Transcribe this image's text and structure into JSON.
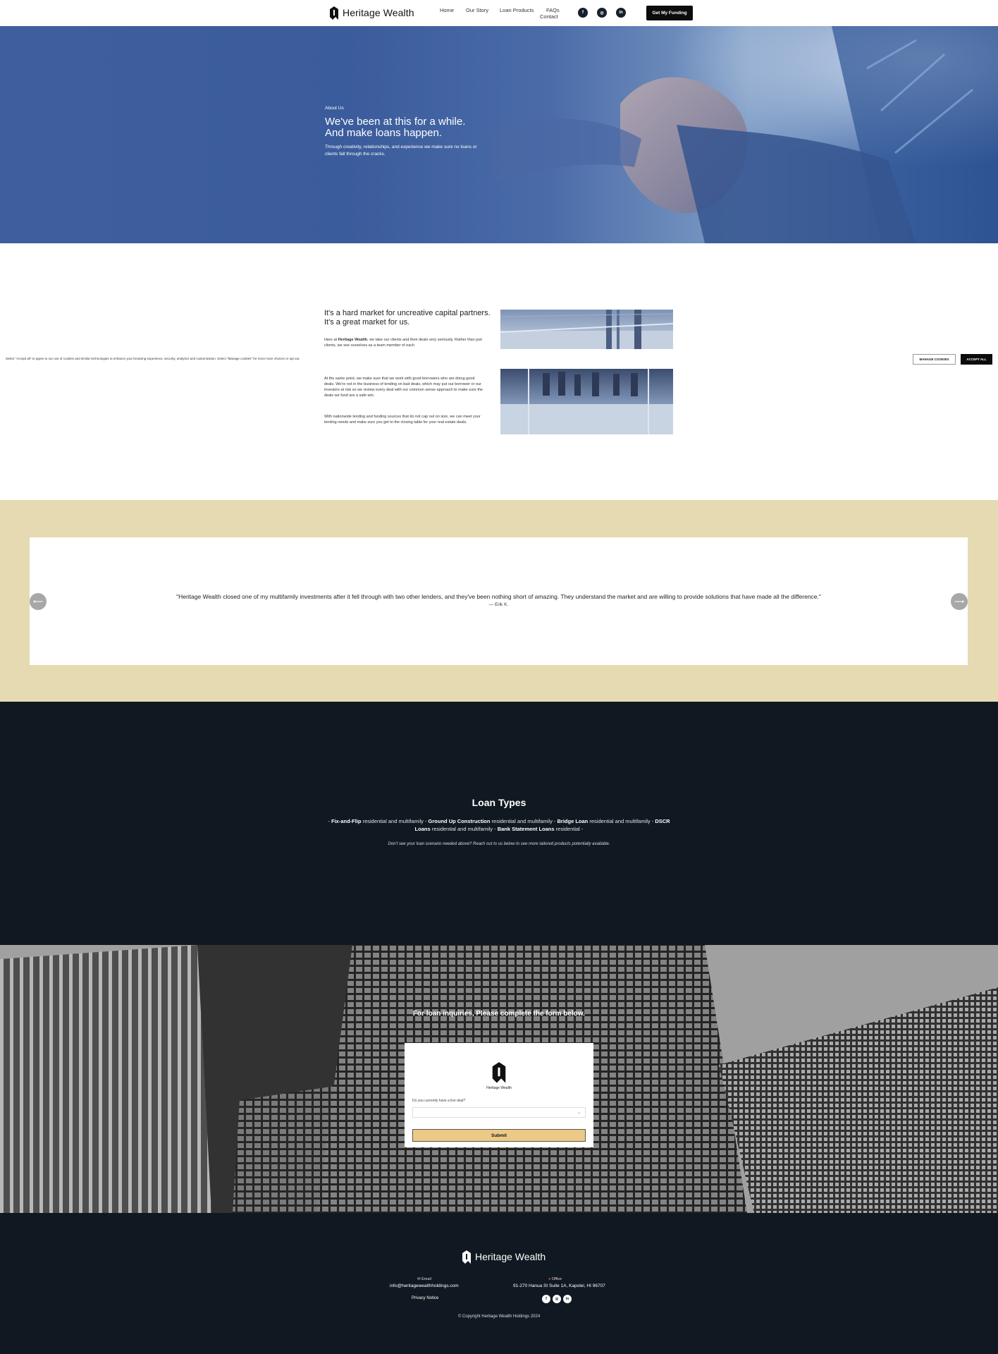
{
  "nav": {
    "brand": "Heritage Wealth",
    "links": [
      "Home",
      "Our Story",
      "Loan Products",
      "FAQs",
      "Contact"
    ],
    "cta": "Get My Funding"
  },
  "hero": {
    "eyebrow": "About Us",
    "heading_line1": "We've been at this for a while.",
    "heading_line2": "And make loans happen.",
    "subtext": "Through creativity, relationships, and experience we make sure no loans or clients fall through the cracks."
  },
  "about": {
    "heading": "It's a hard market for uncreative capital partners. It's a great market for us.",
    "p1_prefix": "Here at ",
    "p1_bold": "Heritage Wealth",
    "p1_rest": ", we take our clients and their deals very seriously. Rather than just clients, we see ourselves as a team member of each",
    "p2": "At the same point, we make sure that we work with good borrowers who are doing good deals. We're not in the business of lending on bad deals, which may put our borrower or our investors at risk so we review every deal with our common sense approach to make sure the deals we fund are a safe win.",
    "p3": "With nationwide lending and funding sources that do not cap out on size, we can meet your lending needs and make sure you get to the closing table for your real estate deals."
  },
  "cookie": {
    "text": "Select \"Accept all\" to agree to our use of cookies and similar technologies to enhance your browsing experience, security, analytics and customization. Select \"Manage cookies\" for more more choices or opt out.",
    "manage": "MANAGE COOKIES",
    "accept": "ACCEPT ALL"
  },
  "testimonial": {
    "quote": "\"Heritage Wealth closed one of my multifamily investments after it fell through with two other lenders, and they've been nothing short of amazing. They understand the market and are willing to provide solutions that have made all the difference.\"",
    "author": "— Erik K."
  },
  "loans": {
    "title": "Loan Types",
    "items": [
      {
        "name": "Fix-and-Flip",
        "desc": "residential and multifamily"
      },
      {
        "name": "Ground Up Construction",
        "desc": "residential and multifamily"
      },
      {
        "name": "Bridge Loan",
        "desc": "residential and multifamily"
      },
      {
        "name": "DSCR Loans",
        "desc": "residential and multifamily"
      },
      {
        "name": "Bank Statement Loans",
        "desc": "residential"
      }
    ],
    "note": "Don't see your loan scenario needed above? Reach out to us below to see more tailored products potentially available."
  },
  "form": {
    "title": "For loan inquiries, Please complete the form below.",
    "logo_text": "Heritage Wealth",
    "label": "Do you currently have a live deal?",
    "select_value": "",
    "submit": "Submit"
  },
  "footer": {
    "brand": "Heritage Wealth",
    "email_label": "Email",
    "email": "info@heritagewealthholdings.com",
    "office_label": "Office",
    "address": "91-270 Hanua St Suite 1A, Kapolei, HI 96707",
    "privacy": "Privacy Notice",
    "copyright": "© Copyright Heritage Wealth Holdings 2024"
  },
  "colors": {
    "dark_navy": "#101921",
    "beige": "#e6dab3",
    "hero_blue": "#3f5e9d",
    "submit_gold": "#ecca86"
  },
  "icons": {
    "social": [
      "facebook-icon",
      "instagram-icon",
      "linkedin-icon"
    ]
  }
}
